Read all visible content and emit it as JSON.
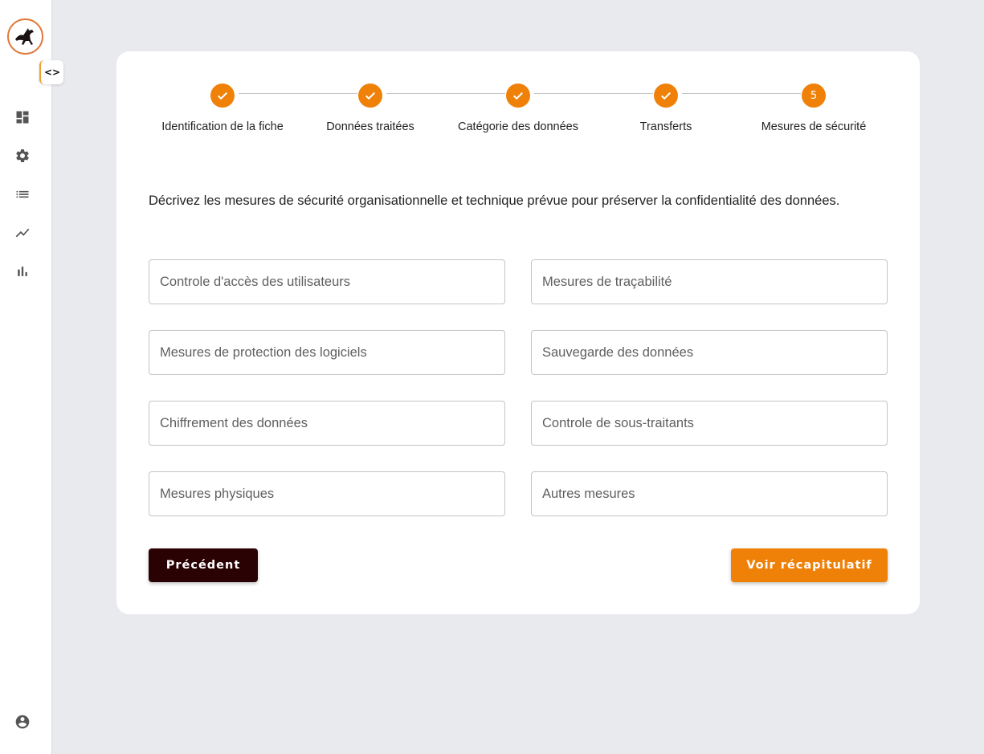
{
  "sidebar": {
    "toggle_label": "<>",
    "items": [
      {
        "icon": "dashboard-icon"
      },
      {
        "icon": "settings-icon"
      },
      {
        "icon": "list-icon"
      },
      {
        "icon": "trending-icon"
      },
      {
        "icon": "bar-chart-icon"
      }
    ],
    "account_icon": "account-icon"
  },
  "stepper": {
    "steps": [
      {
        "label": "Identification de la fiche",
        "status": "completed"
      },
      {
        "label": "Données traitées",
        "status": "completed"
      },
      {
        "label": "Catégorie des données",
        "status": "completed"
      },
      {
        "label": "Transferts",
        "status": "completed"
      },
      {
        "label": "Mesures de sécurité",
        "status": "active",
        "number": "5"
      }
    ]
  },
  "form": {
    "instructions": "Décrivez les mesures de sécurité organisationnelle et technique prévue pour préserver la confidentialité des données.",
    "fields": {
      "controle_acces": {
        "placeholder": "Controle d'accès des utilisateurs",
        "value": ""
      },
      "tracabilite": {
        "placeholder": "Mesures de traçabilité",
        "value": ""
      },
      "protection_logiciels": {
        "placeholder": "Mesures de protection des logiciels",
        "value": ""
      },
      "sauvegarde": {
        "placeholder": "Sauvegarde des données",
        "value": ""
      },
      "chiffrement": {
        "placeholder": "Chiffrement des données",
        "value": ""
      },
      "sous_traitants": {
        "placeholder": "Controle de sous-traitants",
        "value": ""
      },
      "physiques": {
        "placeholder": "Mesures physiques",
        "value": ""
      },
      "autres": {
        "placeholder": "Autres mesures",
        "value": ""
      }
    },
    "buttons": {
      "previous": "Précédent",
      "summary": "Voir récapitulatif"
    }
  },
  "colors": {
    "accent": "#ef8109",
    "dark_button": "#2a0204",
    "background": "#e9eaee"
  }
}
